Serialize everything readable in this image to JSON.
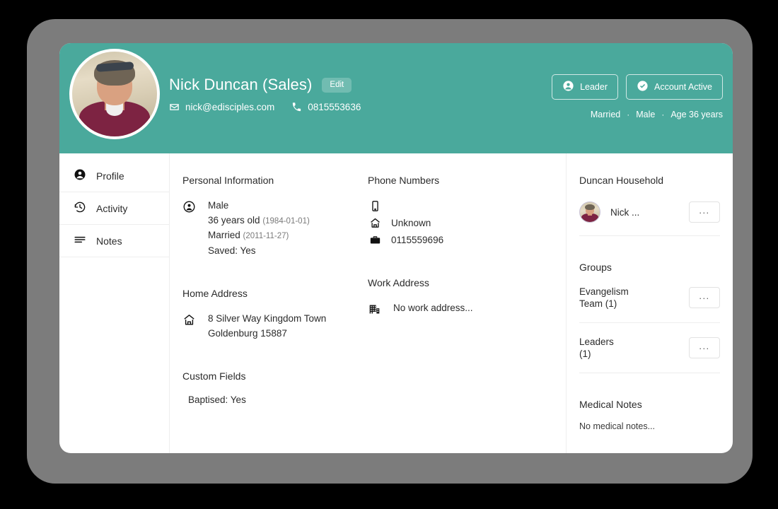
{
  "header": {
    "name": "Nick Duncan (Sales)",
    "edit_label": "Edit",
    "email": "nick@edisciples.com",
    "phone": "0815553636",
    "badges": [
      {
        "label": "Leader",
        "icon": "person-icon"
      },
      {
        "label": "Account Active",
        "icon": "check-circle-icon"
      }
    ],
    "meta": {
      "marital": "Married",
      "gender": "Male",
      "age": "Age 36 years",
      "separator": "·"
    },
    "accent_color": "#4aa99c"
  },
  "sidebar": {
    "items": [
      {
        "label": "Profile",
        "icon": "person-icon"
      },
      {
        "label": "Activity",
        "icon": "history-icon"
      },
      {
        "label": "Notes",
        "icon": "lines-icon"
      }
    ]
  },
  "main": {
    "personal_information": {
      "title": "Personal Information",
      "gender": "Male",
      "age": "36 years old",
      "birth_date": "(1984-01-01)",
      "marital_status": "Married",
      "marriage_date": "(2011-11-27)",
      "saved": "Saved: Yes"
    },
    "home_address": {
      "title": "Home Address",
      "line1": "8 Silver Way Kingdom Town",
      "line2": "Goldenburg 15887"
    },
    "custom_fields": {
      "title": "Custom Fields",
      "entries": [
        "Baptised: Yes"
      ]
    },
    "phone_numbers": {
      "title": "Phone Numbers",
      "rows": [
        {
          "icon": "mobile-icon",
          "value": ""
        },
        {
          "icon": "home-icon",
          "value": "Unknown"
        },
        {
          "icon": "briefcase-icon",
          "value": "0115559696"
        }
      ]
    },
    "work_address": {
      "title": "Work Address",
      "empty_text": "No work address...",
      "icon": "office-building-icon"
    }
  },
  "right_panel": {
    "household": {
      "title": "Duncan Household",
      "members": [
        {
          "name": "Nick ...",
          "menu_label": "..."
        }
      ]
    },
    "groups": {
      "title": "Groups",
      "items": [
        {
          "name": "Evangelism",
          "detail": "Team (1)",
          "menu_label": "..."
        },
        {
          "name": "Leaders",
          "detail": "(1)",
          "menu_label": "..."
        }
      ]
    },
    "medical_notes": {
      "title": "Medical Notes",
      "empty_text": "No medical notes..."
    }
  }
}
